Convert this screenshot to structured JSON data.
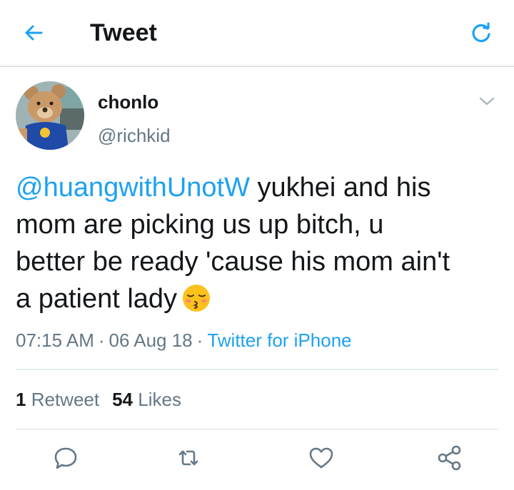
{
  "header": {
    "title": "Tweet",
    "back_icon": "arrow-left-icon",
    "refresh_icon": "refresh-icon"
  },
  "author": {
    "name": "chonlo",
    "handle": "@richkid",
    "avatar": "teddy-bear-avatar"
  },
  "tweet": {
    "mention": "@huangwithUnotW",
    "text_line1": " yukhei and his",
    "text_line2": "mom are picking us up bitch, u",
    "text_line3": "better be ready 'cause his mom ain't",
    "text_line4": "a patient lady",
    "emoji": "kissing-face-with-closed-eyes"
  },
  "meta": {
    "time": "07:15 AM",
    "date": "06 Aug 18",
    "sep": "·",
    "source": "Twitter for iPhone"
  },
  "stats": {
    "retweets": "1",
    "retweets_label": "Retweet",
    "likes": "54",
    "likes_label": "Likes"
  },
  "actions": [
    "reply-icon",
    "retweet-icon",
    "like-icon",
    "share-icon"
  ],
  "colors": {
    "accent": "#1da1f2",
    "text": "#14171a",
    "secondary": "#657786",
    "divider": "#e6ecf0"
  }
}
